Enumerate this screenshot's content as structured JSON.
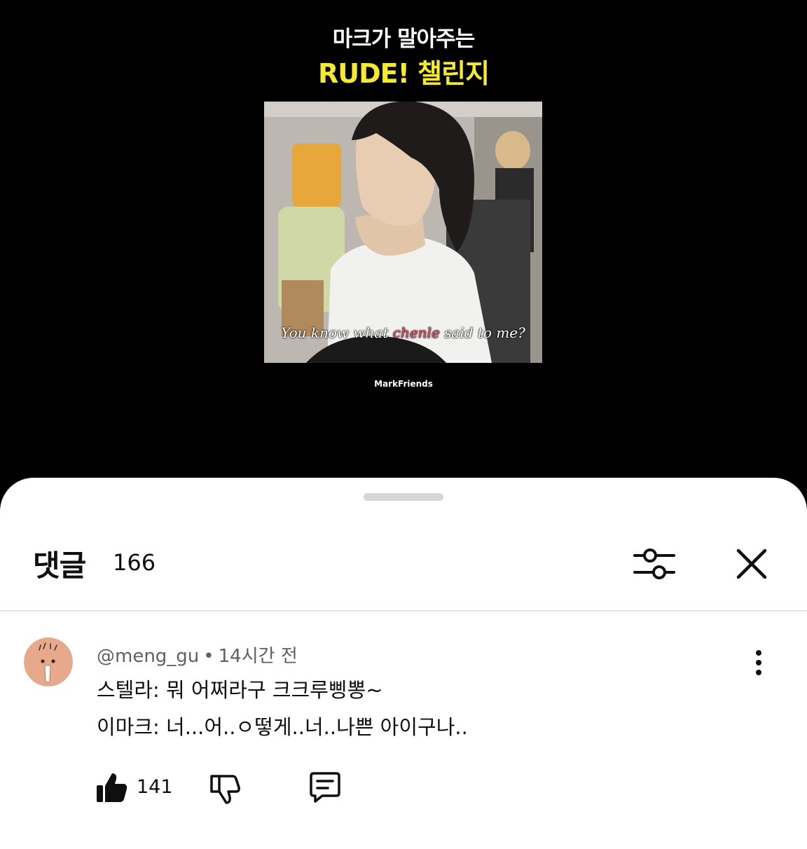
{
  "video": {
    "title_line1": "마크가 말아주는",
    "title_line2": "RUDE! 챌린지",
    "subtitle_before": "You know what ",
    "subtitle_highlight": "chenle",
    "subtitle_after": " said to me?",
    "watermark": "MarkFriends"
  },
  "comments_panel": {
    "title": "댓글",
    "count": "166",
    "icons": {
      "filter": "sliders-icon",
      "close": "close-icon"
    }
  },
  "comment": {
    "author": "@meng_gu",
    "separator": "•",
    "time": "14시간 전",
    "line1": "스텔라: 뭐 어쩌라구 크크루삥뽕~",
    "line2": "이마크: 너...어..ㅇ떻게..너..나쁜 아이구나..",
    "like_count": "141",
    "icons": {
      "like": "thumbs-up-icon",
      "dislike": "thumbs-down-icon",
      "reply": "reply-icon",
      "more": "more-vertical-icon"
    }
  }
}
